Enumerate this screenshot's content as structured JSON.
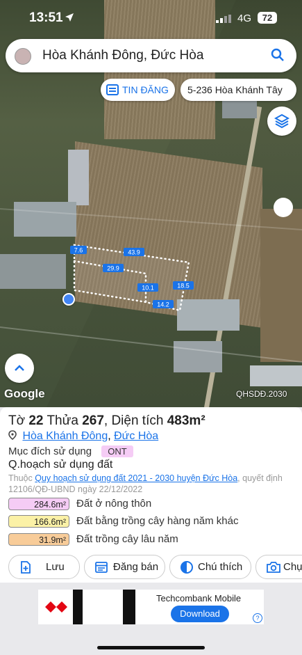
{
  "status_bar": {
    "time": "13:51",
    "network": "4G",
    "battery": "72"
  },
  "search": {
    "text": "Hòa Khánh Đông, Đức Hòa"
  },
  "chips": {
    "tin_dang": "TIN ĐĂNG",
    "address": "5-236 Hòa Khánh Tây"
  },
  "map": {
    "attribution": "Google",
    "layer_code": "QHSDĐ.2030",
    "dimensions": [
      "43.9",
      "7.6",
      "29.9",
      "10.1",
      "18.5",
      "14.2"
    ]
  },
  "parcel": {
    "sheet_prefix": "Tờ",
    "sheet": "22",
    "parcel_prefix": "Thửa",
    "parcel": "267",
    "area_prefix": ", Diện tích",
    "area": "483m²",
    "ward": "Hòa Khánh Đông",
    "separator": ", ",
    "district": "Đức Hòa",
    "purpose_label": "Mục đích sử dụng",
    "purpose_code": "ONT",
    "planning_title": "Q.hoạch sử dụng đất",
    "belongs_prefix": "Thuộc",
    "plan_link": "Quy hoạch sử dụng đất 2021 - 2030 huyện Đức Hòa",
    "decision": ", quyết định 12106/QĐ-UBND ngày 22/12/2022",
    "land_uses": [
      {
        "area": "284.6m²",
        "label": "Đất ở nông thôn",
        "color": "#f5ccf5"
      },
      {
        "area": "166.6m²",
        "label": "Đất bằng trồng cây hàng năm khác",
        "color": "#fbf1a6"
      },
      {
        "area": "31.9m²",
        "label": "Đất trồng cây lâu năm",
        "color": "#f8cc99"
      }
    ]
  },
  "actions": {
    "save": "Lưu",
    "post": "Đăng bán",
    "note": "Chú thích",
    "photo": "Chụ"
  },
  "ad": {
    "name": "Techcombank Mobile",
    "button": "Download",
    "info": "?"
  },
  "colors": {
    "accent": "#1a73e8",
    "parcel_line": "#ffffff",
    "label_bg": "#1a73e8"
  }
}
